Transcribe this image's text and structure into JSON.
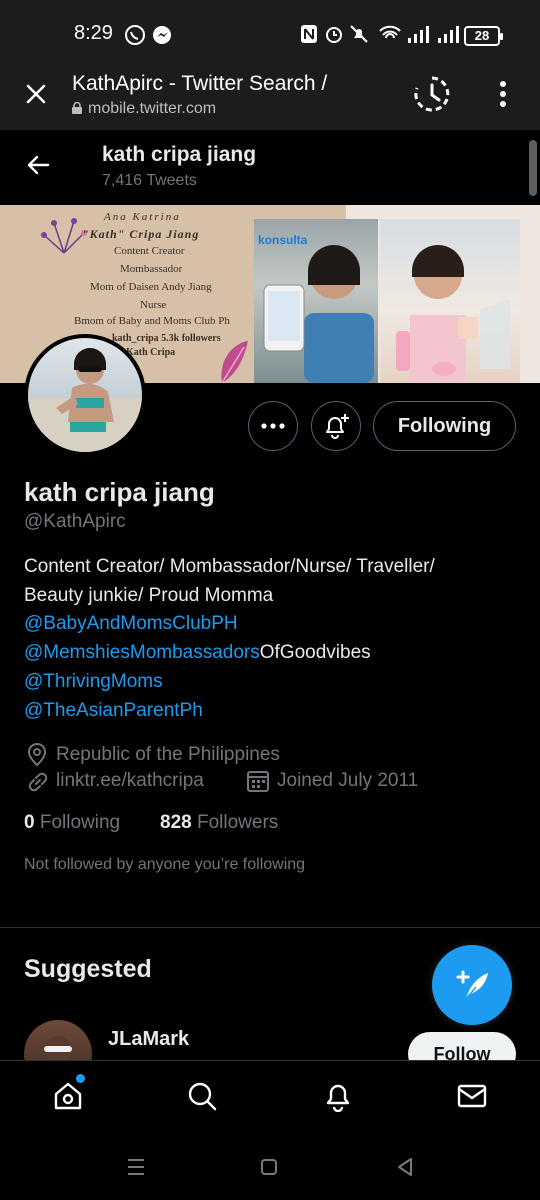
{
  "status_bar": {
    "time": "8:29",
    "battery": "28"
  },
  "browser": {
    "tab_title": "KathApirc - Twitter Search /",
    "url": "mobile.twitter.com"
  },
  "profile_header": {
    "name": "kath cripa jiang",
    "tweet_count": "7,416 Tweets"
  },
  "banner": {
    "lines": [
      "Ana Katrina",
      "\"Kath\" Cripa Jiang",
      "Content Creator",
      "Mombassador",
      "Mom of Daisen Andy Jiang",
      "Nurse",
      "Bmom of Baby and Moms Club Ph",
      "kath_cripa 5.3k followers",
      "Kath Cripa"
    ],
    "photo_label": "konsulta"
  },
  "actions": {
    "follow_label": "Following"
  },
  "profile": {
    "name": "kath cripa jiang",
    "handle": "@KathApirc",
    "bio_line1": "Content Creator/ Mombassador/Nurse/ Traveller/",
    "bio_line2": "Beauty junkie/ Proud Momma",
    "mention1": "@BabyAndMomsClubPH",
    "mention2": "@MemshiesMombassadors",
    "mention2_suffix": "OfGoodvibes",
    "mention3": "@ThrivingMoms",
    "mention4": "@TheAsianParentPh",
    "location": "Republic of the Philippines",
    "website": "linktr.ee/kathcripa",
    "joined": "Joined July 2011",
    "following_count": "0",
    "following_label": "Following",
    "followers_count": "828",
    "followers_label": "Followers",
    "not_followed": "Not followed by anyone you’re following"
  },
  "suggested": {
    "title": "Suggested",
    "user_name": "JLaMark",
    "follow_label": "Follow"
  },
  "colors": {
    "accent": "#1d9bf0",
    "muted": "#71767b",
    "background": "#000000"
  },
  "icons": [
    "close-icon",
    "history-icon",
    "more-vert-icon",
    "back-arrow-icon",
    "more-horizontal-icon",
    "bell-plus-icon",
    "location-icon",
    "link-icon",
    "calendar-icon",
    "compose-icon",
    "home-icon",
    "search-icon",
    "notifications-icon",
    "messages-icon"
  ]
}
